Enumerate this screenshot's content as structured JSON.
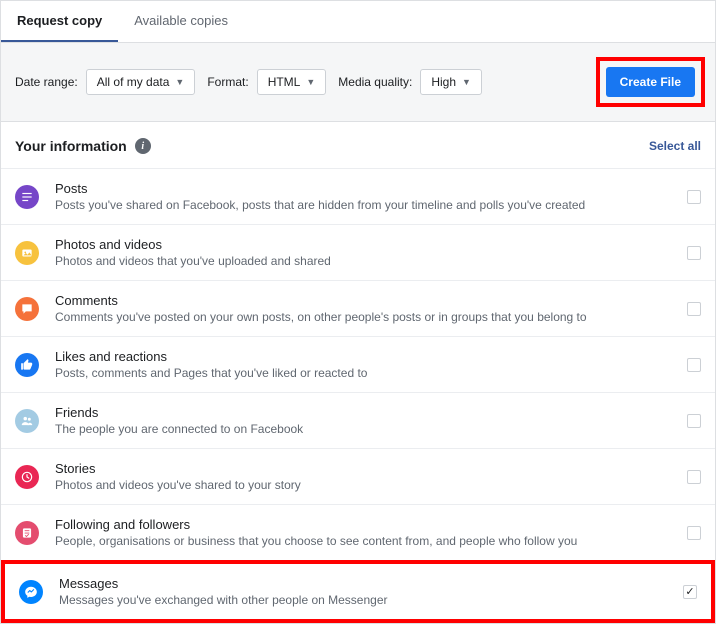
{
  "tabs": {
    "request": "Request copy",
    "available": "Available copies"
  },
  "controls": {
    "dateRangeLabel": "Date range:",
    "dateRangeValue": "All of my data",
    "formatLabel": "Format:",
    "formatValue": "HTML",
    "qualityLabel": "Media quality:",
    "qualityValue": "High",
    "createFile": "Create File"
  },
  "section": {
    "title": "Your information",
    "selectAll": "Select all"
  },
  "items": [
    {
      "title": "Posts",
      "desc": "Posts you've shared on Facebook, posts that are hidden from your timeline and polls you've created",
      "color": "#7646c8",
      "icon": "posts-icon",
      "checked": false
    },
    {
      "title": "Photos and videos",
      "desc": "Photos and videos that you've uploaded and shared",
      "color": "#f7c23e",
      "icon": "photos-icon",
      "checked": false
    },
    {
      "title": "Comments",
      "desc": "Comments you've posted on your own posts, on other people's posts or in groups that you belong to",
      "color": "#f5723b",
      "icon": "comments-icon",
      "checked": false
    },
    {
      "title": "Likes and reactions",
      "desc": "Posts, comments and Pages that you've liked or reacted to",
      "color": "#1877f2",
      "icon": "likes-icon",
      "checked": false
    },
    {
      "title": "Friends",
      "desc": "The people you are connected to on Facebook",
      "color": "#a3cbe3",
      "icon": "friends-icon",
      "checked": false
    },
    {
      "title": "Stories",
      "desc": "Photos and videos you've shared to your story",
      "color": "#e92754",
      "icon": "stories-icon",
      "checked": false
    },
    {
      "title": "Following and followers",
      "desc": "People, organisations or business that you choose to see content from, and people who follow you",
      "color": "#e44d6f",
      "icon": "following-icon",
      "checked": false
    },
    {
      "title": "Messages",
      "desc": "Messages you've exchanged with other people on Messenger",
      "color": "#0084ff",
      "icon": "messages-icon",
      "checked": true
    }
  ]
}
